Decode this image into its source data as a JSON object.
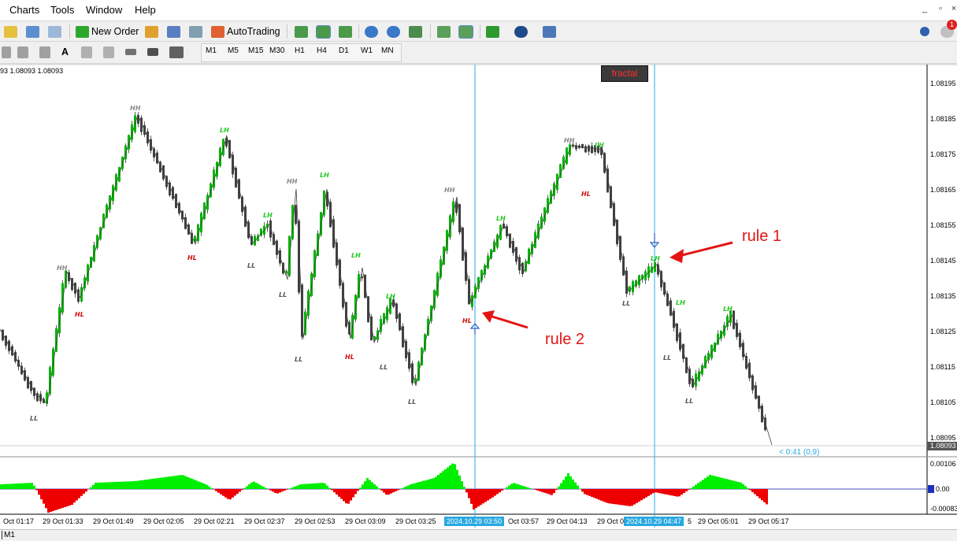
{
  "menu": [
    "Charts",
    "Tools",
    "Window",
    "Help"
  ],
  "window_controls": [
    "_",
    "▫",
    "×"
  ],
  "toolbar": {
    "new_order": "New Order",
    "autotrading": "AutoTrading",
    "notification_count": "1",
    "timeframes": [
      "M1",
      "M5",
      "M15",
      "M30",
      "H1",
      "H4",
      "D1",
      "W1",
      "MN"
    ]
  },
  "chart": {
    "info": "93 1.08093 1.08093",
    "fractal_button": "fractal",
    "price_labels": [
      "1.08195",
      "1.08185",
      "1.08175",
      "1.08165",
      "1.08155",
      "1.08145",
      "1.08135",
      "1.08125",
      "1.08115",
      "1.08105",
      "1.08095"
    ],
    "current_price": "1.08093",
    "countdown": "< 0:41 (0,9)",
    "osc_labels": [
      "0.00106",
      "0.00",
      "-0.00083"
    ],
    "time_labels": [
      "Oct 01:17",
      "29 Oct 01:33",
      "29 Oct 01:49",
      "29 Oct 02:05",
      "29 Oct 02:21",
      "29 Oct 02:37",
      "29 Oct 02:53",
      "29 Oct 03:09",
      "29 Oct 03:25",
      "2024.10.29 03:50",
      "Oct 03:57",
      "29 Oct 04:13",
      "29 Oct 0",
      "2024.10.29 04:47",
      "5",
      "29 Oct 05:01",
      "29 Oct 05:17"
    ],
    "tags": [
      "LL",
      "HH",
      "HL",
      "HH",
      "HL",
      "LH",
      "LL",
      "LL",
      "HH",
      "LH",
      "LH",
      "LL",
      "LH",
      "HL",
      "LL",
      "LH",
      "LL",
      "HH",
      "HL",
      "LH",
      "HH",
      "LH",
      "HL",
      "LH",
      "LL",
      "LL",
      "LH",
      "LH",
      "LL"
    ],
    "annotations": {
      "rule1": "rule 1",
      "rule2": "rule 2"
    },
    "colors": {
      "bull": "#00b400",
      "bear": "#404040",
      "vline": "#29a8e0",
      "arrow": "#e41414",
      "osc_pos": "#00ee00",
      "osc_neg": "#ee0000"
    }
  },
  "bottom_tab": "M1"
}
